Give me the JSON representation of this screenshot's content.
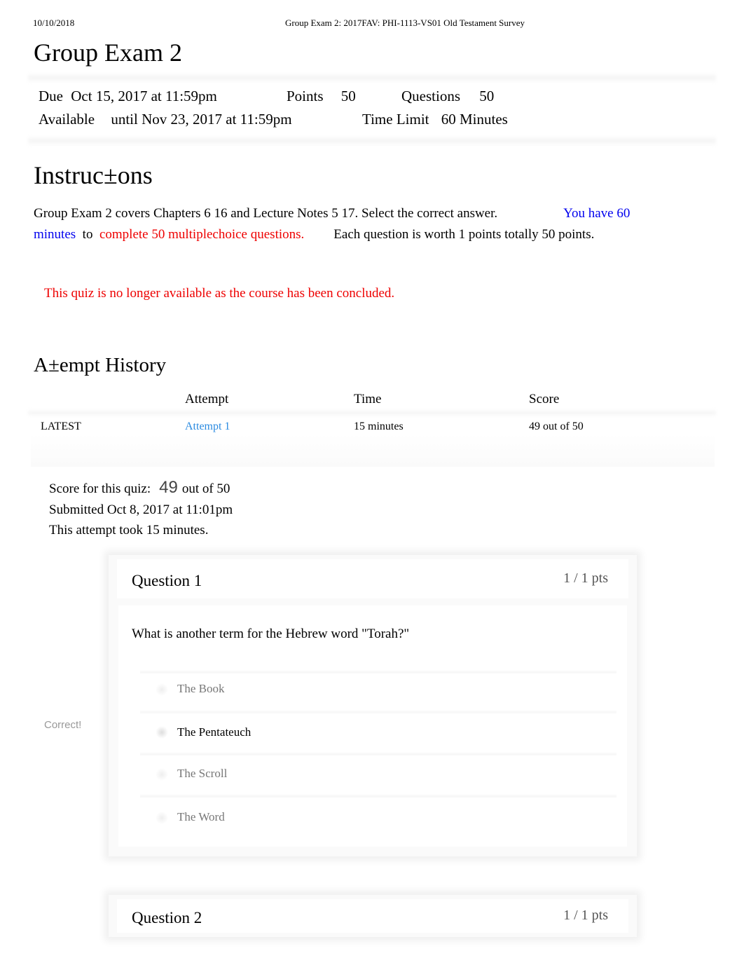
{
  "print_header": {
    "date": "10/10/2018",
    "title": "Group Exam 2: 2017FAV: PHI-1113-VS01 Old Testament Survey"
  },
  "page_title": "Group Exam 2",
  "quiz_meta": {
    "due_label": "Due",
    "due_value": "Oct 15, 2017 at 11:59pm",
    "points_label": "Points",
    "points_value": "50",
    "questions_label": "Questions",
    "questions_value": "50",
    "available_label": "Available",
    "available_value": "until Nov 23, 2017 at 11:59pm",
    "time_limit_label": "Time Limit",
    "time_limit_value": "60 Minutes"
  },
  "instructions": {
    "heading": "Instruc±ons",
    "part1": "Group Exam 2 covers Chapters 6  16 and Lecture Notes 5  17. Select the correct answer.",
    "part2_blue": "You have 60 minutes",
    "part3": "to",
    "part4_red": "complete 50 multiplechoice questions.",
    "part5": "Each question is worth 1 points totally 50 points."
  },
  "notice": "This quiz is no longer available as the course has been concluded.",
  "attempt_history": {
    "heading": "A±empt History",
    "columns": [
      "",
      "Attempt",
      "Time",
      "Score"
    ],
    "rows": [
      {
        "tag": "LATEST",
        "attempt": "Attempt 1",
        "time": "15 minutes",
        "score": "49 out of 50"
      }
    ]
  },
  "score_summary": {
    "score_label": "Score for this quiz:",
    "score_value": "49",
    "score_total": "out of 50",
    "submitted": "Submitted Oct 8, 2017 at 11:01pm",
    "duration": "This attempt took 15 minutes."
  },
  "questions": [
    {
      "title": "Question 1",
      "points": "1 / 1 pts",
      "text": "What is another term for the Hebrew word \"Torah?\"",
      "result_label": "Correct!",
      "answers": [
        {
          "label": "The Book",
          "selected": false
        },
        {
          "label": "The Pentateuch",
          "selected": true
        },
        {
          "label": "The Scroll",
          "selected": false
        },
        {
          "label": "The Word",
          "selected": false
        }
      ]
    },
    {
      "title": "Question 2",
      "points": "1 / 1 pts"
    }
  ],
  "colors": {
    "link_blue": "#2a8ae0",
    "instruction_blue": "#0000ee",
    "alert_red": "#ee0000"
  }
}
